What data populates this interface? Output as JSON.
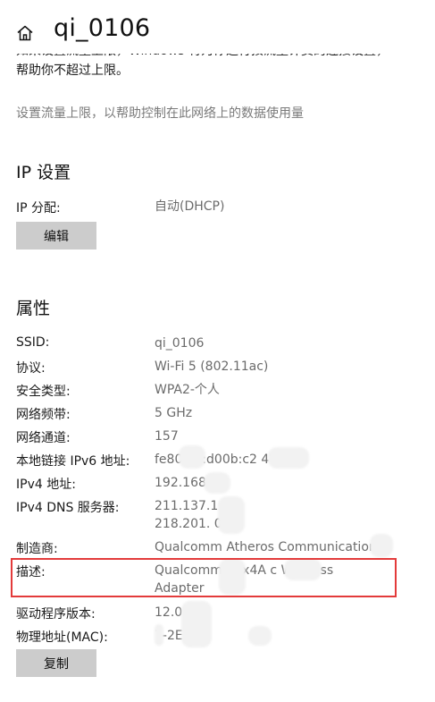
{
  "header": {
    "title": "qi_0106",
    "home_icon": "home-icon"
  },
  "metered": {
    "intro_line1": "如果设置流量上限，Windows 将为你进行按流量计费的连接设置，",
    "intro_line2": "帮助你不超过上限。",
    "hint": "设置流量上限，以帮助控制在此网络上的数据使用量"
  },
  "ip_settings": {
    "title": "IP 设置",
    "assignment_label": "IP 分配:",
    "assignment_value": "自动(DHCP)",
    "edit_button": "编辑"
  },
  "properties": {
    "title": "属性",
    "rows": [
      {
        "label": "SSID:",
        "value": "qi_0106"
      },
      {
        "label": "协议:",
        "value": "Wi-Fi 5 (802.11ac)"
      },
      {
        "label": "安全类型:",
        "value": "WPA2-个人"
      },
      {
        "label": "网络频带:",
        "value": "5 GHz"
      },
      {
        "label": "网络通道:",
        "value": "157"
      },
      {
        "label": "本地链接 IPv6 地址:",
        "value": "fe80      e8:d00b:c2       4%29"
      },
      {
        "label": "IPv4 地址:",
        "value": "192.168.1"
      },
      {
        "label": "IPv4 DNS 服务器:",
        "value": "211.137.1      5",
        "value2": "218.201.      0"
      },
      {
        "label": "制造商:",
        "value": "Qualcomm Atheros Communications"
      },
      {
        "label": "描述:",
        "value": "Qualcomm      61x4A         c Wireless",
        "value2": "Adapter"
      },
      {
        "label": "驱动程序版本:",
        "value": "12.0.0"
      },
      {
        "label": "物理地址(MAC):",
        "value": "       7-2E-8"
      }
    ],
    "copy_button": "复制"
  },
  "colors": {
    "highlight_border": "#e33b3b",
    "button_bg": "#cccccc",
    "value_text": "#6b6b6b"
  }
}
